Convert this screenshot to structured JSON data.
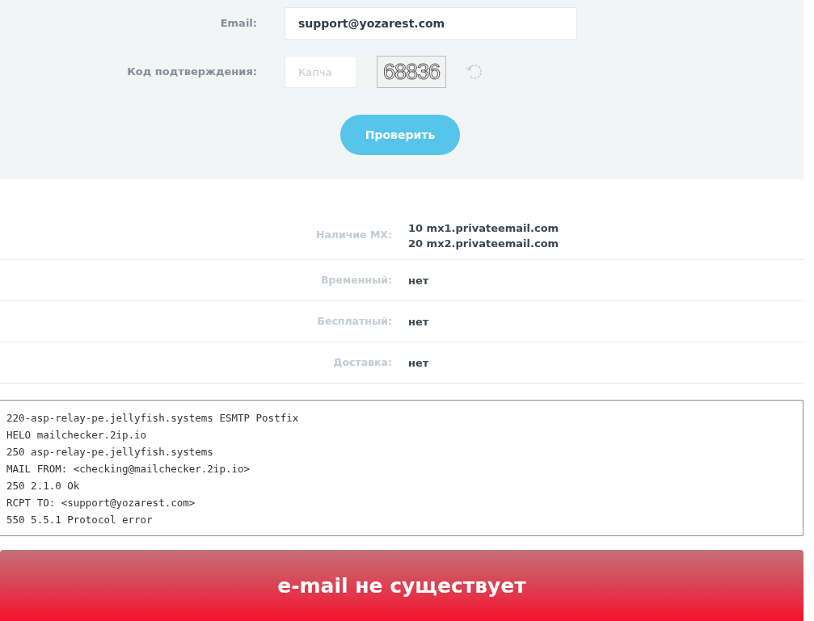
{
  "form": {
    "email_label": "Email:",
    "email_value": "support@yozarest.com",
    "captcha_label": "Код подтверждения:",
    "captcha_placeholder": "Капча",
    "captcha_code": "68836",
    "submit": "Проверить"
  },
  "results": [
    {
      "label": "Наличие MX:",
      "values": [
        "**10** mx1.privateemail.com",
        "**20** mx2.privateemail.com"
      ]
    },
    {
      "label": "Временный:",
      "values": [
        "нет"
      ]
    },
    {
      "label": "Бесплатный:",
      "values": [
        "нет"
      ]
    },
    {
      "label": "Доставка:",
      "values": [
        "нет"
      ]
    }
  ],
  "smtp_log": [
    "220-asp-relay-pe.jellyfish.systems ESMTP Postfix",
    "HELO mailchecker.2ip.io",
    "250 asp-relay-pe.jellyfish.systems",
    "MAIL FROM: <checking@mailchecker.2ip.io>",
    "250 2.1.0 Ok",
    "RCPT TO: <support@yozarest.com>",
    "550 5.5.1 Protocol error"
  ],
  "verdict": {
    "text": "e-mail не существует",
    "kind": "error"
  }
}
